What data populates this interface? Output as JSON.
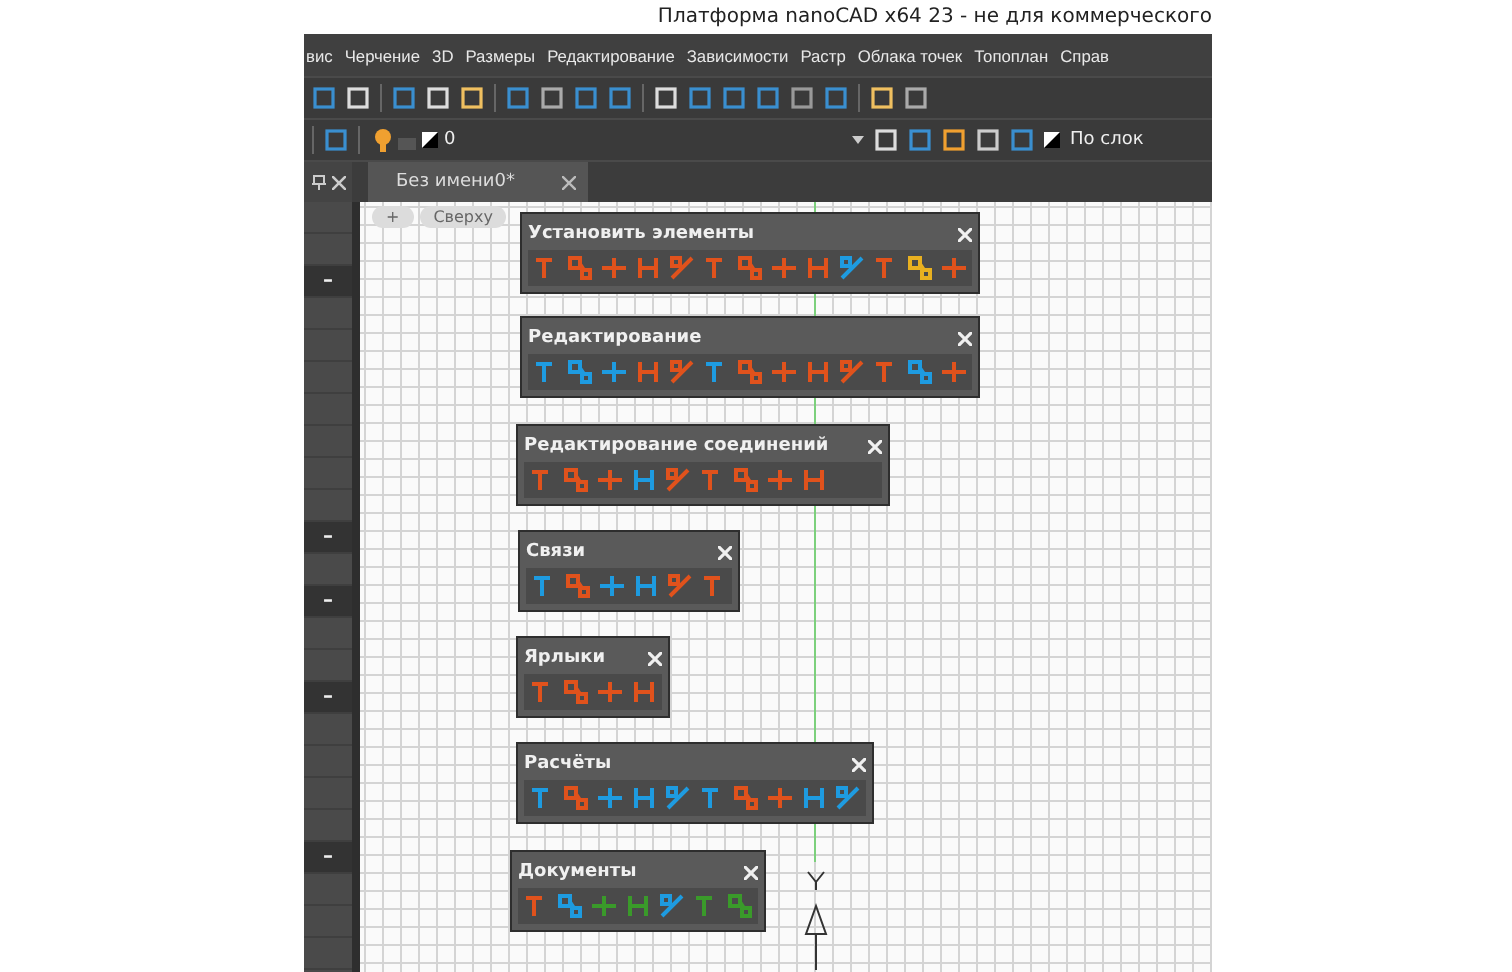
{
  "window": {
    "title": "Платформа nanoCAD x64 23 - не для коммерческого"
  },
  "menu": [
    "вис",
    "Черчение",
    "3D",
    "Размеры",
    "Редактирование",
    "Зависимости",
    "Растр",
    "Облака точек",
    "Топоплан",
    "Справ"
  ],
  "layer_bar": {
    "layer": "0",
    "linetype": "По слок"
  },
  "tabs": [
    {
      "label": "Без имени0*",
      "selected": true
    }
  ],
  "view_controls": [
    "+",
    "Сверху"
  ],
  "side_panel": {
    "rows": [
      {
        "kind": "plain"
      },
      {
        "kind": "plain"
      },
      {
        "kind": "group",
        "toggle": "–"
      },
      {
        "kind": "plain"
      },
      {
        "kind": "plain"
      },
      {
        "kind": "plain"
      },
      {
        "kind": "plain"
      },
      {
        "kind": "plain"
      },
      {
        "kind": "plain"
      },
      {
        "kind": "plain"
      },
      {
        "kind": "group",
        "toggle": "–"
      },
      {
        "kind": "plain"
      },
      {
        "kind": "group",
        "toggle": "–"
      },
      {
        "kind": "plain"
      },
      {
        "kind": "plain"
      },
      {
        "kind": "group",
        "toggle": "–"
      },
      {
        "kind": "plain"
      },
      {
        "kind": "plain"
      },
      {
        "kind": "plain"
      },
      {
        "kind": "plain"
      },
      {
        "kind": "group",
        "toggle": "–"
      },
      {
        "kind": "plain"
      },
      {
        "kind": "plain"
      },
      {
        "kind": "plain"
      }
    ]
  },
  "palettes": [
    {
      "title": "Установить элементы",
      "icons": [
        {
          "color": "#e0521c"
        },
        {
          "color": "#e0521c"
        },
        {
          "color": "#e0521c"
        },
        {
          "color": "#e0521c"
        },
        {
          "color": "#e0521c"
        },
        {
          "color": "#e0521c"
        },
        {
          "color": "#e0521c"
        },
        {
          "color": "#e0521c"
        },
        {
          "color": "#e0521c"
        },
        {
          "color": "#1e9be0"
        },
        {
          "color": "#e0521c"
        },
        {
          "color": "#e8b020"
        },
        {
          "color": "#e0521c"
        }
      ]
    },
    {
      "title": "Редактирование",
      "icons": [
        {
          "color": "#1e9be0"
        },
        {
          "color": "#1e9be0"
        },
        {
          "color": "#1e9be0"
        },
        {
          "color": "#e0521c"
        },
        {
          "color": "#e0521c"
        },
        {
          "color": "#1e9be0"
        },
        {
          "color": "#e0521c"
        },
        {
          "color": "#e0521c"
        },
        {
          "color": "#e0521c"
        },
        {
          "color": "#e0521c"
        },
        {
          "color": "#e0521c"
        },
        {
          "color": "#1e9be0"
        },
        {
          "color": "#e0521c"
        }
      ]
    },
    {
      "title": "Редактирование соединений",
      "icons": [
        {
          "color": "#e0521c"
        },
        {
          "color": "#e0521c"
        },
        {
          "color": "#e0521c"
        },
        {
          "color": "#1e9be0"
        },
        {
          "color": "#e0521c"
        },
        {
          "color": "#e0521c"
        },
        {
          "color": "#e0521c"
        },
        {
          "color": "#e0521c"
        },
        {
          "color": "#e0521c"
        }
      ]
    },
    {
      "title": "Связи",
      "icons": [
        {
          "color": "#1e9be0"
        },
        {
          "color": "#e0521c"
        },
        {
          "color": "#1e9be0"
        },
        {
          "color": "#1e9be0"
        },
        {
          "color": "#e0521c"
        },
        {
          "color": "#e0521c"
        }
      ]
    },
    {
      "title": "Ярлыки",
      "icons": [
        {
          "color": "#e0521c"
        },
        {
          "color": "#e0521c"
        },
        {
          "color": "#e0521c"
        },
        {
          "color": "#e0521c"
        }
      ]
    },
    {
      "title": "Расчёты",
      "icons": [
        {
          "color": "#1e9be0"
        },
        {
          "color": "#e0521c"
        },
        {
          "color": "#1e9be0"
        },
        {
          "color": "#1e9be0"
        },
        {
          "color": "#1e9be0"
        },
        {
          "color": "#1e9be0"
        },
        {
          "color": "#e0521c"
        },
        {
          "color": "#e0521c"
        },
        {
          "color": "#1e9be0"
        },
        {
          "color": "#1e9be0"
        }
      ]
    },
    {
      "title": "Документы",
      "icons": [
        {
          "color": "#e0521c"
        },
        {
          "color": "#1e9be0"
        },
        {
          "color": "#3a9a2a"
        },
        {
          "color": "#3a9a2a"
        },
        {
          "color": "#1e9be0"
        },
        {
          "color": "#3a9a2a"
        },
        {
          "color": "#3a9a2a"
        }
      ]
    }
  ]
}
